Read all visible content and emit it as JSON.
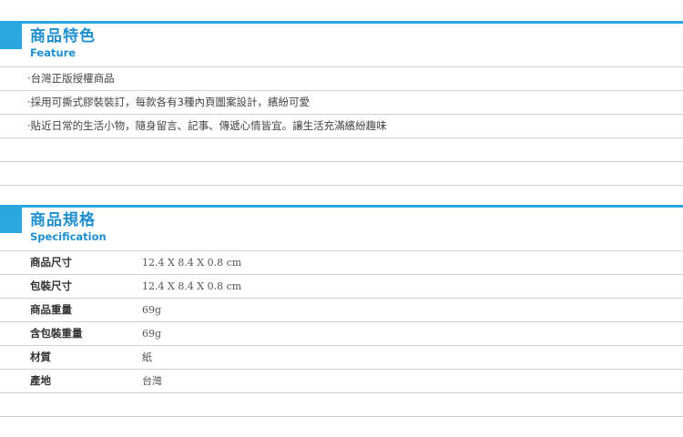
{
  "feature": {
    "title_zh": "商品特色",
    "title_en": "Feature",
    "items": [
      "‧台灣正版授權商品",
      "‧採用可撕式膠裝裝訂，每款各有3種內頁圖案設計，繽紛可愛",
      "‧貼近日常的生活小物，隨身留言、記事、傳遞心情皆宜。讓生活充滿繽紛趣味",
      "",
      ""
    ]
  },
  "spec": {
    "title_zh": "商品規格",
    "title_en": "Specification",
    "rows": [
      {
        "label": "商品尺寸",
        "value": "12.4 X 8.4 X 0.8 cm"
      },
      {
        "label": "包裝尺寸",
        "value": "12.4 X 8.4 X 0.8 cm"
      },
      {
        "label": "商品重量",
        "value": "69g"
      },
      {
        "label": "含包裝重量",
        "value": "69g"
      },
      {
        "label": "材質",
        "value": "紙"
      },
      {
        "label": "產地",
        "value": "台灣"
      },
      {
        "label": "",
        "value": ""
      }
    ]
  },
  "colors": {
    "accent": "#2aa6de",
    "title": "#1f8fd0",
    "rule": "#cfcfcf"
  }
}
